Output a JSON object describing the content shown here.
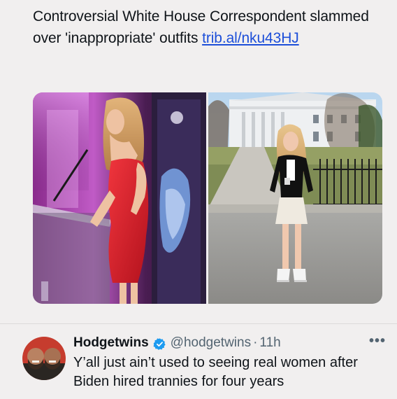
{
  "tweet": {
    "text": "Controversial White House Correspondent slammed over 'inappropriate' outfits ",
    "link_text": "trib.al/nku43HJ"
  },
  "media": {
    "left_photo": {
      "icon": "speaker-at-podium-red-dress-photo"
    },
    "right_photo": {
      "icon": "woman-outside-white-house-photo"
    }
  },
  "reply": {
    "display_name": "Hodgetwins",
    "verified_icon": "verified-badge-icon",
    "handle": "@hodgetwins",
    "separator": "·",
    "time": "11h",
    "more_label": "•••",
    "text": "Y’all just ain’t used to seeing real women after Biden hired trannies for four years"
  },
  "colors": {
    "link": "#1d4fd9",
    "verified": "#1d9bf0",
    "secondary_text": "#536471",
    "background": "#f1efef"
  }
}
